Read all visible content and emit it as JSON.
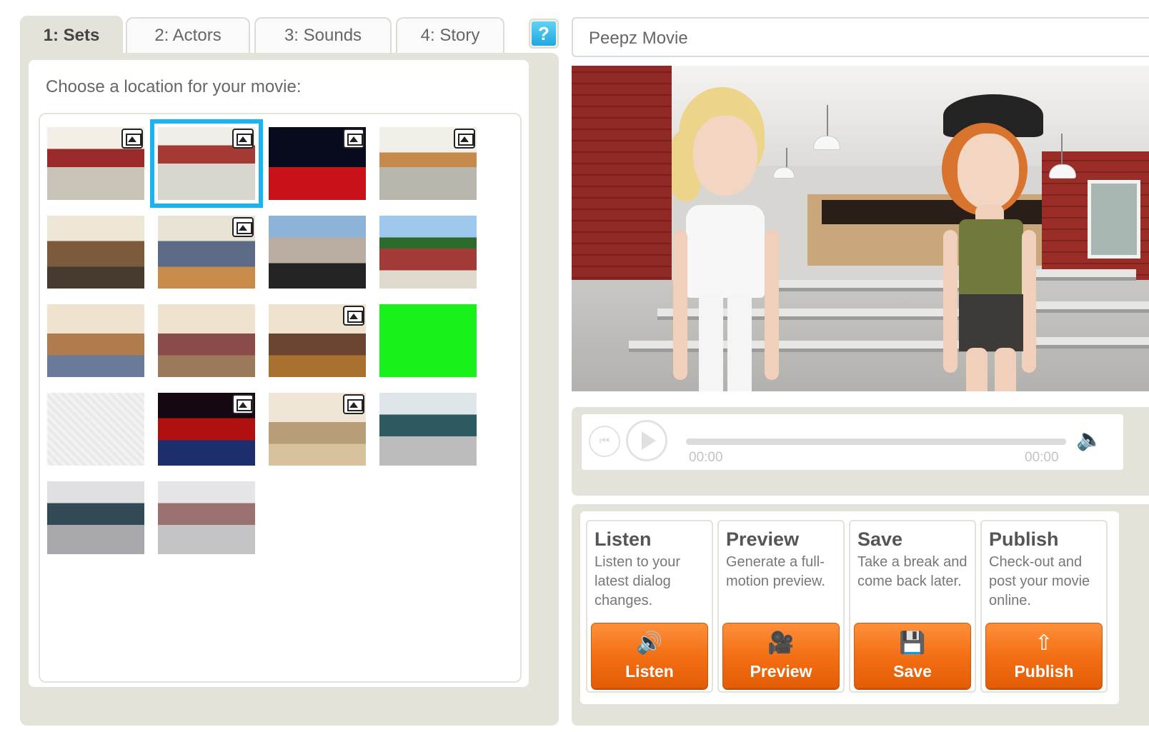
{
  "tabs": [
    {
      "label": "1: Sets"
    },
    {
      "label": "2: Actors"
    },
    {
      "label": "3: Sounds"
    },
    {
      "label": "4: Story"
    }
  ],
  "help": {
    "label": "?"
  },
  "sets": {
    "prompt": "Choose a location for your movie:",
    "selected_index": 1
  },
  "movie": {
    "title": "Peepz Movie"
  },
  "player": {
    "current_time": "00:00",
    "total_time": "00:00",
    "progress": 0
  },
  "actions": [
    {
      "title": "Listen",
      "description": "Listen to your latest dialog changes.",
      "button": "Listen",
      "icon": "speaker-icon"
    },
    {
      "title": "Preview",
      "description": "Generate a full-motion preview.",
      "button": "Preview",
      "icon": "camera-icon"
    },
    {
      "title": "Save",
      "description": "Take a break and come back later.",
      "button": "Save",
      "icon": "save-icon"
    },
    {
      "title": "Publish",
      "description": "Check-out and post your movie online.",
      "button": "Publish",
      "icon": "upload-icon"
    }
  ],
  "colors": {
    "accent_blue": "#19b4f2",
    "button_orange": "#f26d12",
    "panel_bg": "#e3e3da",
    "green_screen": "#19f21a"
  }
}
